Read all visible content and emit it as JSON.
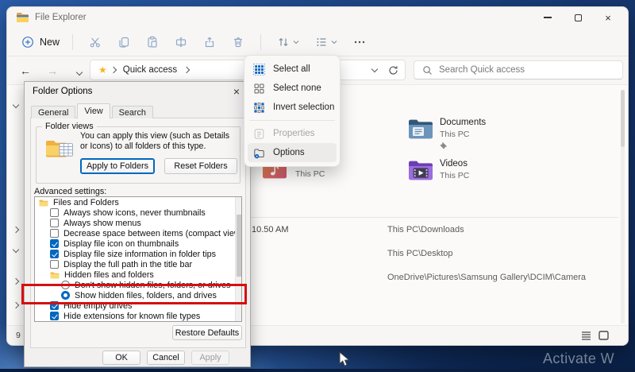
{
  "desktop": {
    "watermark_text": "Activate W"
  },
  "window": {
    "title": "File Explorer",
    "status_count": "9",
    "controls": [
      "minimize",
      "maximize",
      "close"
    ],
    "toolbar": {
      "new_label": "New",
      "icon_names": [
        "plus-circle-icon",
        "cut-icon",
        "copy-icon",
        "paste-icon",
        "rename-icon",
        "share-icon",
        "delete-icon",
        "sort-icon",
        "view-icon",
        "more-icon"
      ]
    },
    "navbar": {
      "breadcrumb_root": "Quick access",
      "search_placeholder": "Search Quick access",
      "icon_names": [
        "back-icon",
        "forward-icon",
        "recent-locations-chevron-icon",
        "up-icon",
        "quick-access-star-icon",
        "refresh-icon",
        "search-icon"
      ]
    },
    "tiles": [
      {
        "name": "",
        "location": "This PC",
        "icon": "music-folder-icon"
      },
      {
        "name": "Documents",
        "location": "This PC",
        "icon": "documents-folder-icon",
        "pinned": true
      },
      {
        "name": "Videos",
        "location": "This PC",
        "icon": "videos-folder-icon"
      }
    ],
    "recent_files": [
      {
        "date_modified": "10.50 AM",
        "location": "This PC\\Downloads"
      },
      {
        "date_modified": "",
        "location": "This PC\\Desktop"
      },
      {
        "date_modified": "",
        "location": "OneDrive\\Pictures\\Samsung Gallery\\DCIM\\Camera"
      }
    ]
  },
  "see_more_menu": {
    "items": [
      {
        "label": "Select all",
        "icon": "select-all-icon",
        "disabled": false,
        "hovered": false
      },
      {
        "label": "Select none",
        "icon": "select-none-icon",
        "disabled": false,
        "hovered": false
      },
      {
        "label": "Invert selection",
        "icon": "invert-selection-icon",
        "disabled": false,
        "hovered": false
      },
      {
        "label": "Properties",
        "icon": "properties-icon",
        "disabled": true,
        "hovered": false
      },
      {
        "label": "Options",
        "icon": "options-icon",
        "disabled": false,
        "hovered": true
      }
    ]
  },
  "folder_options_dialog": {
    "title": "Folder Options",
    "tabs": [
      {
        "label": "General",
        "active": false
      },
      {
        "label": "View",
        "active": true
      },
      {
        "label": "Search",
        "active": false
      }
    ],
    "folder_views": {
      "group_label": "Folder views",
      "description": "You can apply this view (such as Details or Icons) to all folders of this type.",
      "apply_button": "Apply to Folders",
      "reset_button": "Reset Folders"
    },
    "advanced_label": "Advanced settings:",
    "settings": [
      {
        "type": "group",
        "indent": 0,
        "label": "Files and Folders"
      },
      {
        "type": "checkbox",
        "indent": 1,
        "label": "Always show icons, never thumbnails",
        "checked": false
      },
      {
        "type": "checkbox",
        "indent": 1,
        "label": "Always show menus",
        "checked": false
      },
      {
        "type": "checkbox",
        "indent": 1,
        "label": "Decrease space between items (compact view)",
        "checked": false
      },
      {
        "type": "checkbox",
        "indent": 1,
        "label": "Display file icon on thumbnails",
        "checked": true
      },
      {
        "type": "checkbox",
        "indent": 1,
        "label": "Display file size information in folder tips",
        "checked": true
      },
      {
        "type": "checkbox",
        "indent": 1,
        "label": "Display the full path in the title bar",
        "checked": false
      },
      {
        "type": "group",
        "indent": 1,
        "label": "Hidden files and folders"
      },
      {
        "type": "radio",
        "indent": 2,
        "label": "Don't show hidden files, folders, or drives",
        "checked": false
      },
      {
        "type": "radio",
        "indent": 2,
        "label": "Show hidden files, folders, and drives",
        "checked": true,
        "highlighted": true
      },
      {
        "type": "checkbox",
        "indent": 1,
        "label": "Hide empty drives",
        "checked": true
      },
      {
        "type": "checkbox",
        "indent": 1,
        "label": "Hide extensions for known file types",
        "checked": true
      }
    ],
    "restore_button": "Restore Defaults",
    "ok_button": "OK",
    "cancel_button": "Cancel",
    "apply_button": "Apply",
    "apply_enabled": false,
    "highlight_color": "#d60f0f",
    "accent_color": "#0067c0"
  }
}
